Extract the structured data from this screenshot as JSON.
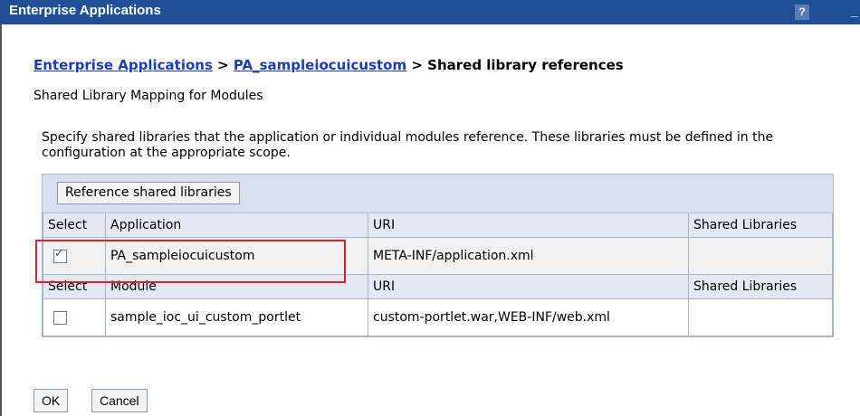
{
  "window": {
    "title": "Enterprise Applications",
    "help_label": "?",
    "minimize_label": "_"
  },
  "breadcrumb": {
    "link1": "Enterprise Applications",
    "sep1": " > ",
    "link2": "PA_sampleiocuicustom",
    "sep2": " > ",
    "current": "Shared library references"
  },
  "subtitle": "Shared Library Mapping for Modules",
  "description": "Specify shared libraries that the application or individual modules reference. These libraries must be defined in the configuration at the appropriate scope.",
  "toolbar": {
    "reference_button": "Reference shared libraries"
  },
  "app_table": {
    "headers": [
      "Select",
      "Application",
      "URI",
      "Shared Libraries"
    ],
    "row": {
      "checked": true,
      "name": "PA_sampleiocuicustom",
      "uri": "META-INF/application.xml",
      "libraries": ""
    }
  },
  "module_table": {
    "headers": [
      "Select",
      "Module",
      "URI",
      "Shared Libraries"
    ],
    "row": {
      "checked": false,
      "name": "sample_ioc_ui_custom_portlet",
      "uri": "custom-portlet.war,WEB-INF/web.xml",
      "libraries": ""
    }
  },
  "buttons": {
    "ok": "OK",
    "cancel": "Cancel"
  }
}
